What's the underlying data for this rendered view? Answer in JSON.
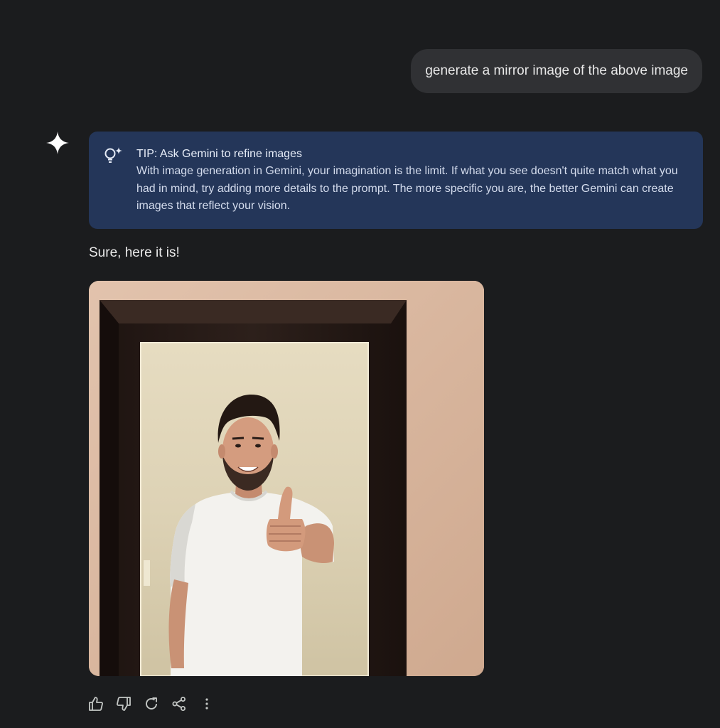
{
  "user_message": {
    "text": "generate a mirror image of the above image"
  },
  "assistant": {
    "avatar_icon": "gemini-spark-icon",
    "tip": {
      "icon": "lightbulb-sparkle-icon",
      "title": "TIP: Ask Gemini to refine images",
      "body": "With image generation in Gemini, your imagination is the limit. If what you see doesn't quite match what you had in mind, try adding more details to the prompt. The more specific you are, the better Gemini can create images that reflect your vision."
    },
    "reply_text": "Sure, here it is!",
    "image": {
      "subject": "man in white t-shirt giving thumbs up inside a dark wooden mirror frame"
    },
    "actions": [
      {
        "name": "thumbs-up-icon"
      },
      {
        "name": "thumbs-down-icon"
      },
      {
        "name": "regenerate-icon"
      },
      {
        "name": "share-icon"
      },
      {
        "name": "more-options-icon"
      }
    ]
  },
  "colors": {
    "background": "#1b1c1e",
    "user_bubble": "#303134",
    "tip_card": "#243659",
    "icon": "#c4c7c5"
  }
}
